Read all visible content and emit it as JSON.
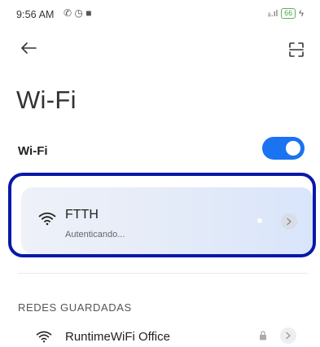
{
  "status_bar": {
    "time": "9:56 AM",
    "left_icons": "✆ ◷ ■",
    "signal": "ᵢᵢ.ıl",
    "battery": "66"
  },
  "header": {
    "back_icon": "back-arrow-icon",
    "scan_icon": "qr-scan-icon"
  },
  "page": {
    "title": "Wi-Fi"
  },
  "wifi_toggle": {
    "label": "Wi-Fi",
    "enabled": true,
    "accent_color": "#1a73f0"
  },
  "current_network": {
    "name": "FTTH",
    "status": "Autenticando...",
    "highlight_color": "#0a18a8"
  },
  "saved_networks": {
    "header": "REDES GUARDADAS",
    "items": [
      {
        "name": "RuntimeWiFi Office",
        "secured": true
      }
    ]
  }
}
